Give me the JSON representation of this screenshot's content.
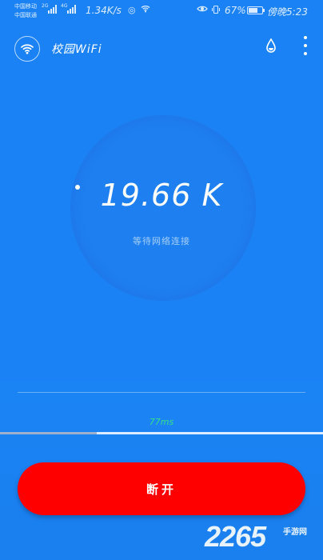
{
  "status_bar": {
    "carrier_1": "中国移动",
    "carrier_2": "中国联通",
    "net_tag_1": "2G",
    "net_tag_2": "4G",
    "speed": "1.34K/s",
    "battery_pct": "67%",
    "battery_level": 0.67,
    "time": "傍晚5:23"
  },
  "header": {
    "title": "校园WiFi",
    "logo_icon": "wifi-icon",
    "theme_icon": "droplet-icon",
    "menu_icon": "more-vertical-icon"
  },
  "gauge": {
    "rate": "19.66 K",
    "message": "等待网络连接"
  },
  "network": {
    "latency": "77ms",
    "progress": 0.3
  },
  "actions": {
    "disconnect_label": "断开"
  },
  "watermark": {
    "brand": "2265",
    "site": "手游网"
  },
  "colors": {
    "background": "#1a82f4",
    "button": "#ff0000",
    "latency": "#35e08c"
  }
}
